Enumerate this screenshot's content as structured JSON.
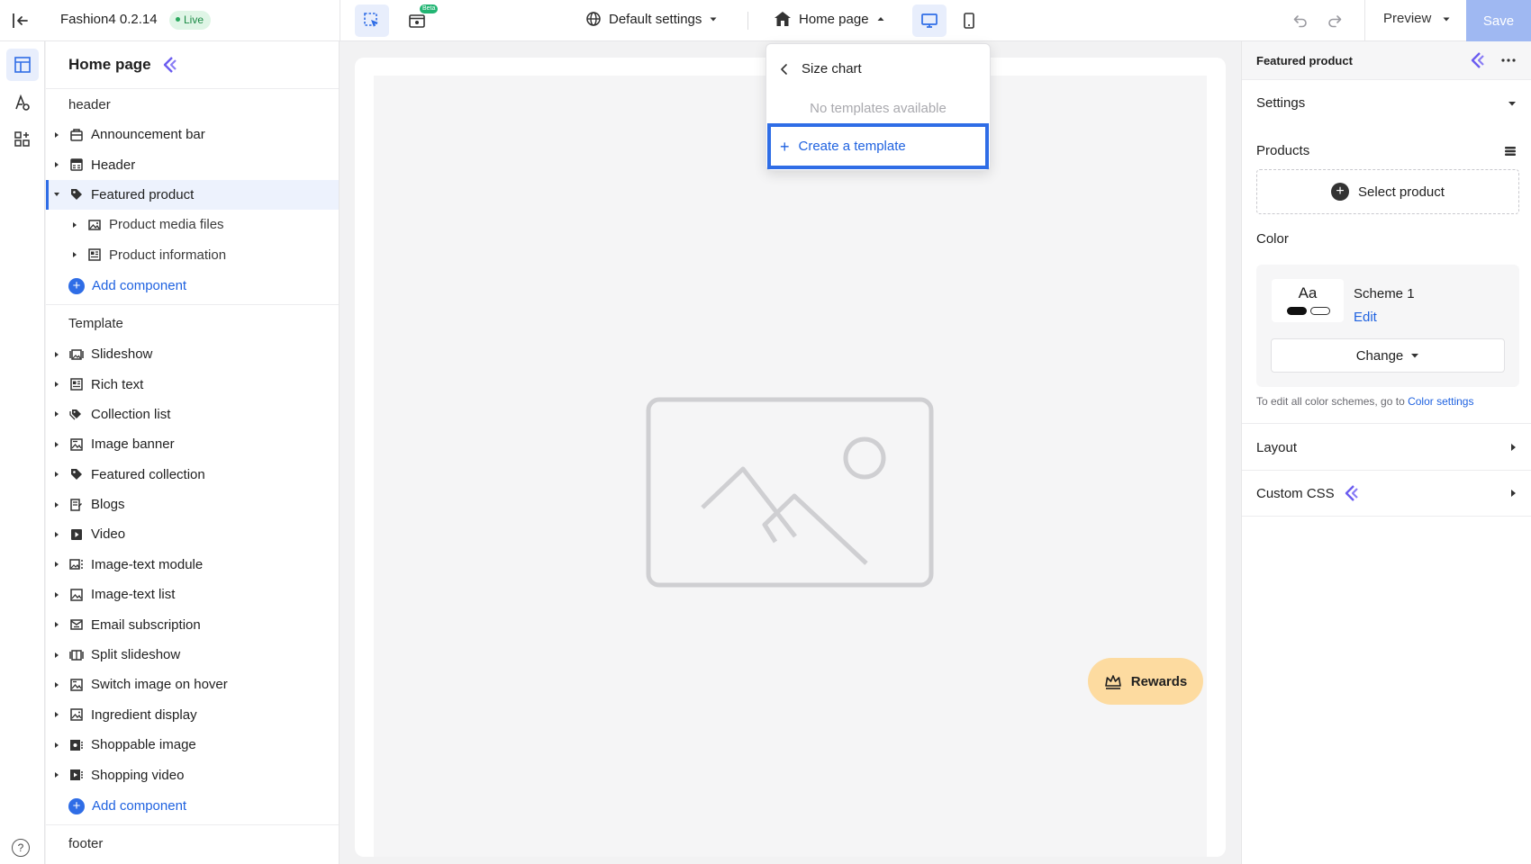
{
  "topbar": {
    "app_title": "Fashion4 0.2.14",
    "live_label": "Live",
    "beta_label": "Beta",
    "settings_select": "Default settings",
    "page_select": "Home page",
    "preview_label": "Preview",
    "save_label": "Save"
  },
  "left_panel": {
    "title": "Home page",
    "header_group": "header",
    "header_items": [
      {
        "label": "Announcement bar"
      },
      {
        "label": "Header"
      },
      {
        "label": "Featured product"
      },
      {
        "label": "Product media files"
      },
      {
        "label": "Product information"
      }
    ],
    "add_component_1": "Add component",
    "template_group": "Template",
    "template_items": [
      {
        "label": "Slideshow"
      },
      {
        "label": "Rich text"
      },
      {
        "label": "Collection list"
      },
      {
        "label": "Image banner"
      },
      {
        "label": "Featured collection"
      },
      {
        "label": "Blogs"
      },
      {
        "label": "Video"
      },
      {
        "label": "Image-text module"
      },
      {
        "label": "Image-text list"
      },
      {
        "label": "Email subscription"
      },
      {
        "label": "Split slideshow"
      },
      {
        "label": "Switch image on hover"
      },
      {
        "label": "Ingredient display"
      },
      {
        "label": "Shoppable image"
      },
      {
        "label": "Shopping video"
      }
    ],
    "add_component_2": "Add component",
    "footer_group": "footer"
  },
  "dropdown": {
    "back_label": "Size chart",
    "empty_text": "No templates available",
    "create_label": "Create a template"
  },
  "canvas": {
    "rewards_label": "Rewards"
  },
  "right_panel": {
    "title": "Featured product",
    "settings_label": "Settings",
    "products_label": "Products",
    "select_product_label": "Select product",
    "color_label": "Color",
    "swatch_text": "Aa",
    "scheme_name": "Scheme 1",
    "edit_label": "Edit",
    "change_label": "Change",
    "color_hint": "To edit all color schemes, go to",
    "color_settings_link": "Color settings",
    "layout_label": "Layout",
    "custom_css_label": "Custom CSS"
  },
  "colors": {
    "accent": "#2f6de6",
    "live_bg": "#dff5e6",
    "save_bg": "#9fb8f2",
    "rewards_bg": "#fddba0"
  }
}
